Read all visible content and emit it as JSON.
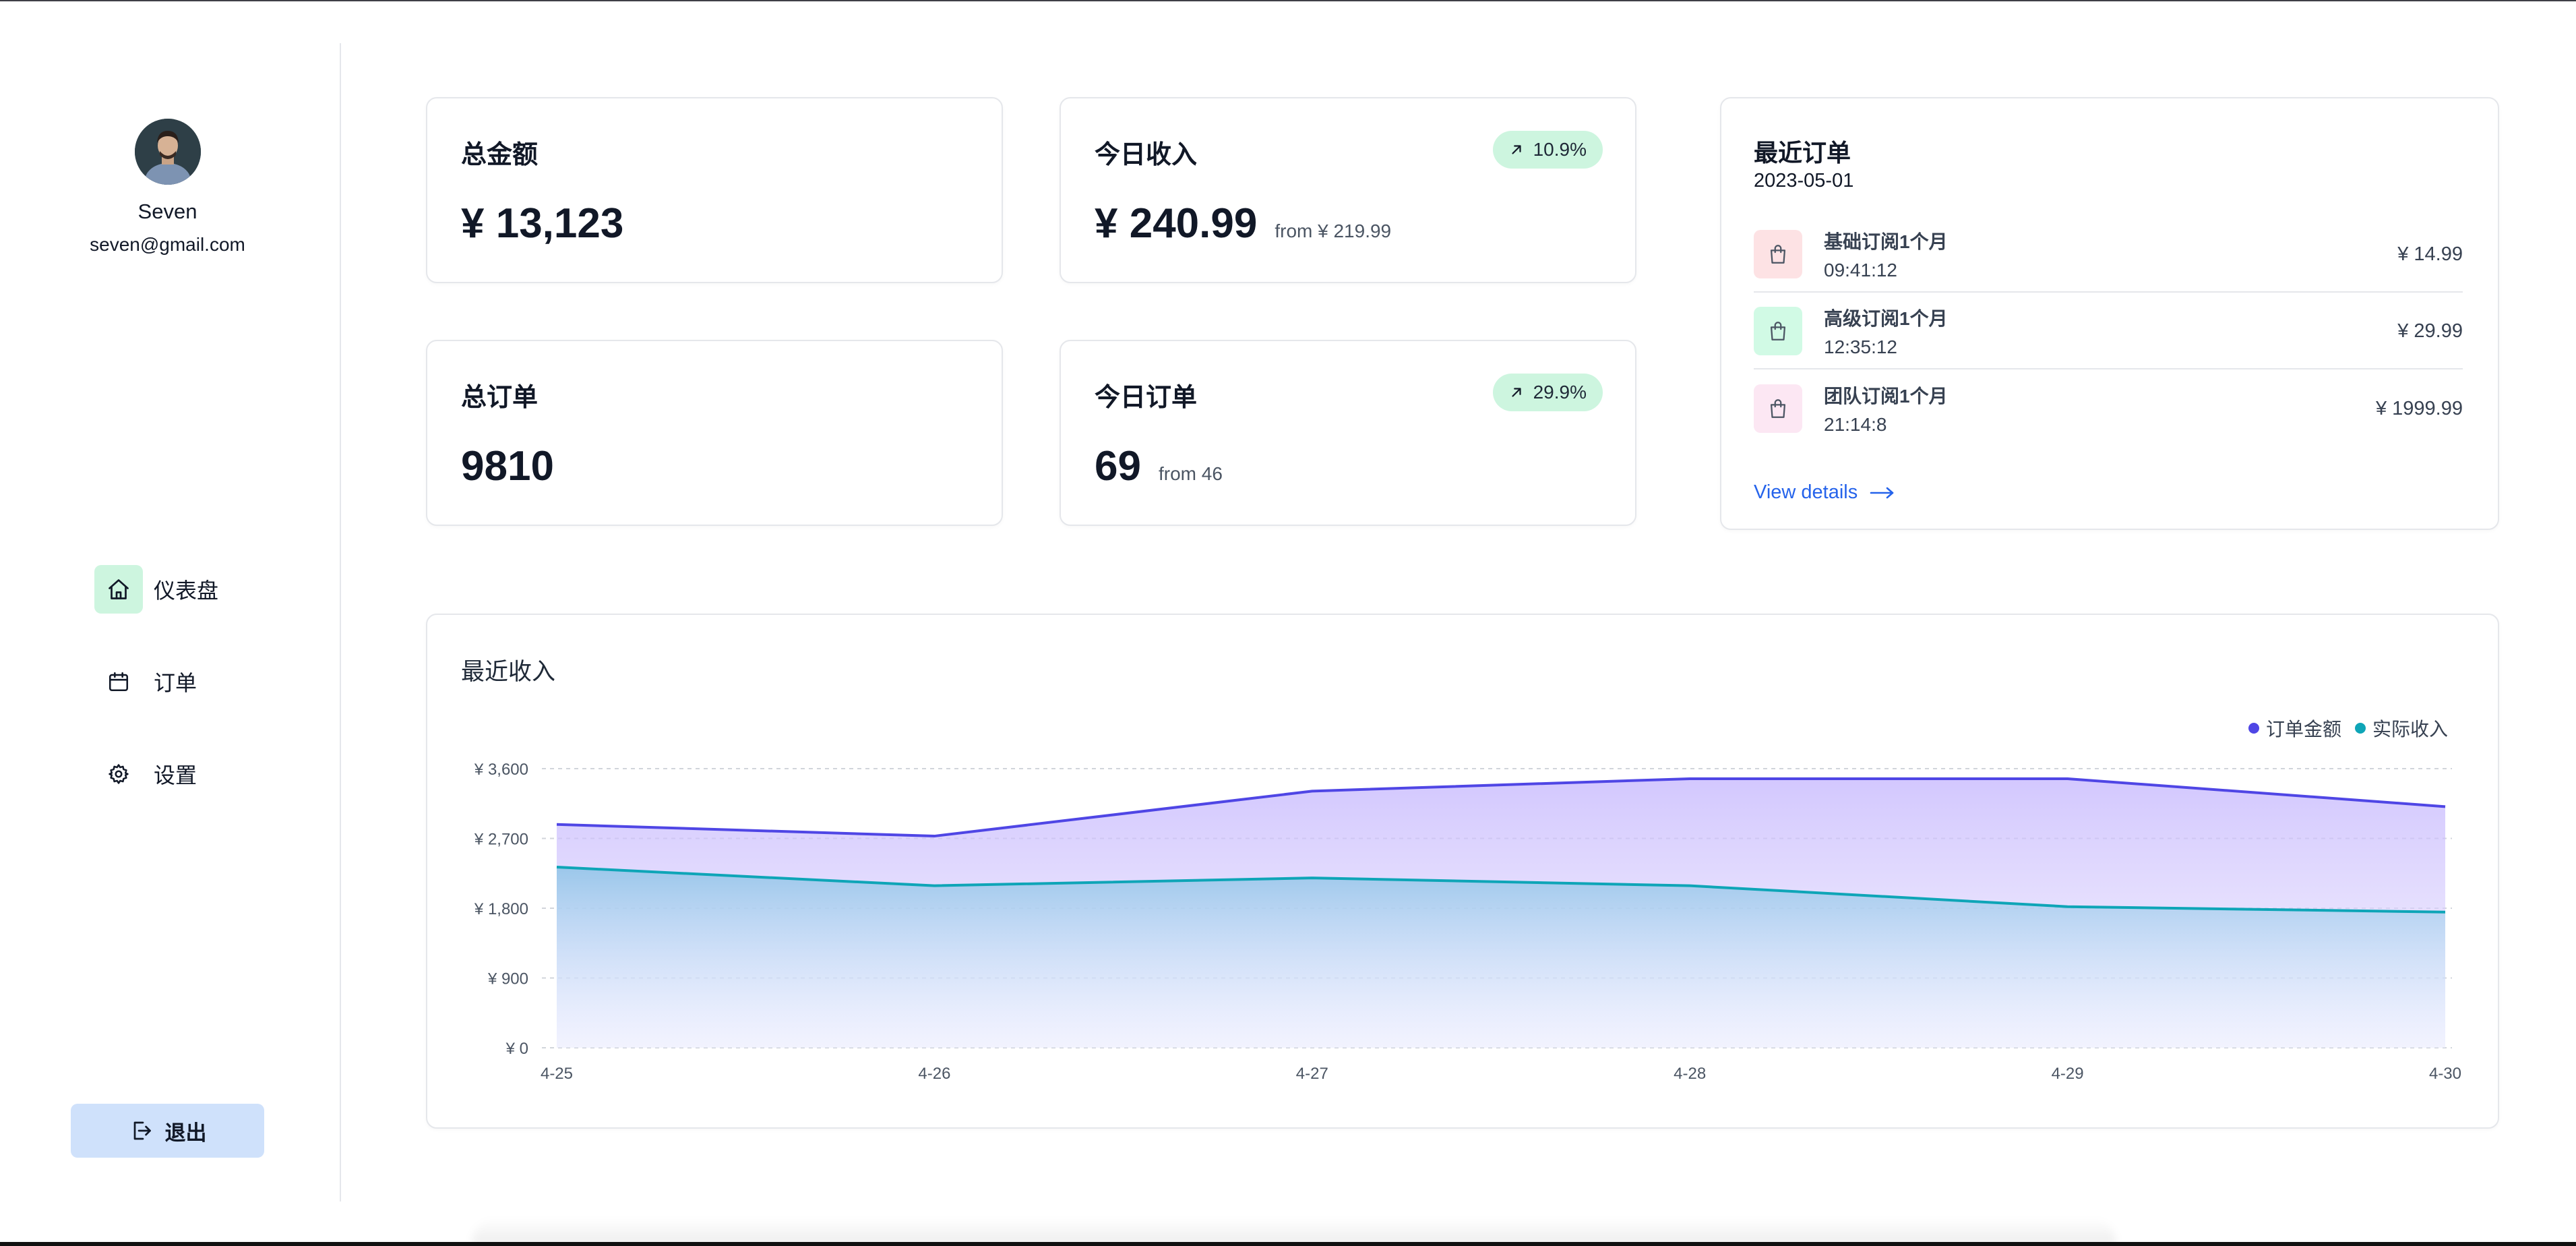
{
  "user": {
    "name": "Seven",
    "email": "seven@gmail.com"
  },
  "nav": [
    {
      "label": "仪表盘",
      "icon": "home-icon",
      "active": true
    },
    {
      "label": "订单",
      "icon": "calendar-icon",
      "active": false
    },
    {
      "label": "设置",
      "icon": "gear-icon",
      "active": false
    }
  ],
  "logout": {
    "label": "退出"
  },
  "stats": {
    "total_amount": {
      "title": "总金额",
      "value": "¥ 13,123"
    },
    "today_income": {
      "title": "今日收入",
      "value": "¥ 240.99",
      "from": "from ¥ 219.99",
      "badge": "10.9%"
    },
    "total_orders": {
      "title": "总订单",
      "value": "9810"
    },
    "today_orders": {
      "title": "今日订单",
      "value": "69",
      "from": "from 46",
      "badge": "29.9%"
    }
  },
  "recent_orders": {
    "title": "最近订单",
    "date": "2023-05-01",
    "items": [
      {
        "name": "基础订阅1个月",
        "time": "09:41:12",
        "price": "¥ 14.99",
        "color": "#fde2e4",
        "icon": "shopping-bag-icon"
      },
      {
        "name": "高级订阅1个月",
        "time": "12:35:12",
        "price": "¥ 29.99",
        "color": "#d1fae5",
        "icon": "shopping-bag-icon"
      },
      {
        "name": "团队订阅1个月",
        "time": "21:14:8",
        "price": "¥ 1999.99",
        "color": "#fce7f3",
        "icon": "shopping-bag-icon"
      }
    ],
    "view_details": "View details"
  },
  "chart_data": {
    "type": "area",
    "title": "最近收入",
    "categories": [
      "4-25",
      "4-26",
      "4-27",
      "4-28",
      "4-29",
      "4-30"
    ],
    "y_ticks": [
      "¥ 0",
      "¥ 900",
      "¥ 1,800",
      "¥ 2,700",
      "¥ 3,600"
    ],
    "ylim": [
      0,
      3600
    ],
    "grid": true,
    "legend_position": "top-right",
    "series": [
      {
        "name": "订单金额",
        "color": "#4f46e5",
        "values": [
          2880,
          2730,
          3310,
          3470,
          3470,
          3110
        ]
      },
      {
        "name": "实际收入",
        "color": "#0ea5b7",
        "values": [
          2330,
          2090,
          2190,
          2090,
          1820,
          1750
        ]
      }
    ]
  }
}
